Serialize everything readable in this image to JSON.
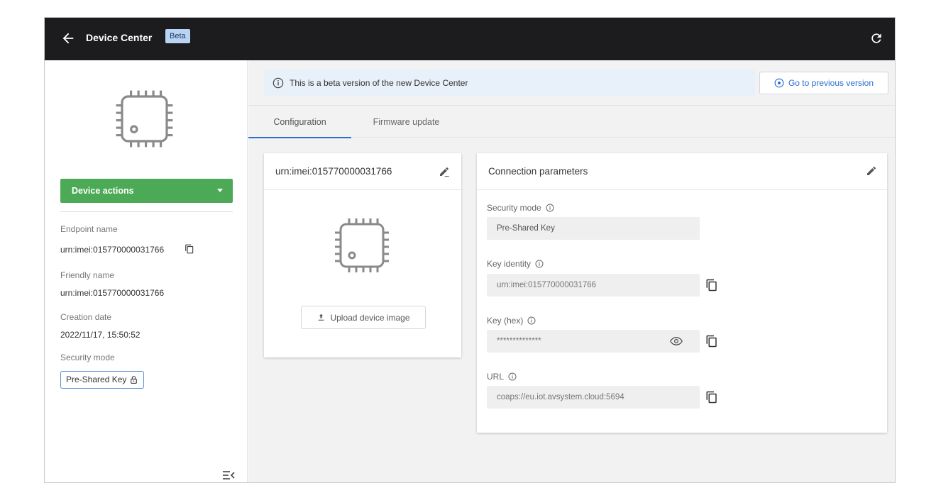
{
  "topbar": {
    "title": "Device Center",
    "badge": "Beta",
    "back_icon": "arrow-left-icon",
    "refresh_icon": "refresh-icon",
    "background": "#1c1c1e"
  },
  "sidebar": {
    "device_actions_label": "Device actions",
    "device_actions_color": "#4caa57",
    "fields": {
      "endpoint_label": "Endpoint name",
      "endpoint_value": "urn:imei:015770000031766",
      "friendly_label": "Friendly name",
      "friendly_value": "urn:imei:015770000031766",
      "creation_label": "Creation date",
      "creation_value": "2022/11/17, 15:50:52",
      "security_label": "Security mode",
      "security_value": "Pre-Shared Key"
    }
  },
  "banner": {
    "text": "This is a beta version of the new Device Center",
    "prev_version_label": "Go to previous version"
  },
  "tabs": [
    {
      "label": "Configuration",
      "active": true
    },
    {
      "label": "Firmware update",
      "active": false
    }
  ],
  "device_card": {
    "title": "urn:imei:015770000031766",
    "upload_label": "Upload device image"
  },
  "connection": {
    "title": "Connection parameters",
    "security_mode_label": "Security mode",
    "security_mode_value": "Pre-Shared Key",
    "key_identity_label": "Key identity",
    "key_identity_value": "urn:imei:015770000031766",
    "key_hex_label": "Key (hex)",
    "key_hex_value": "**************",
    "url_label": "URL",
    "url_value": "coaps://eu.iot.avsystem.cloud:5694"
  },
  "colors": {
    "accent": "#2b6ed2",
    "banner_bg": "#e8f0fa",
    "content_bg": "#f2f2f2"
  }
}
